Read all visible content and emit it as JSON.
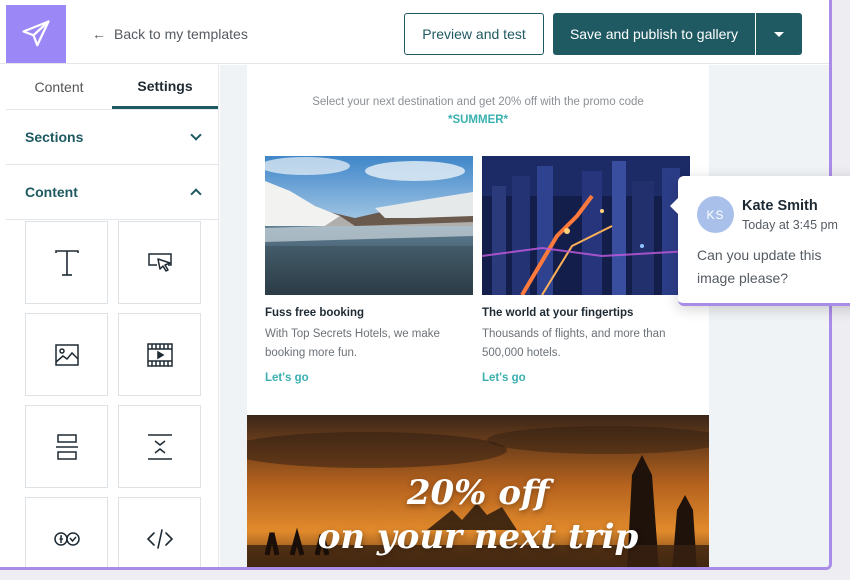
{
  "topbar": {
    "back_label": "Back to my templates",
    "preview_label": "Preview and test",
    "save_label": "Save and publish to gallery"
  },
  "sidebar": {
    "tabs": [
      {
        "label": "Content",
        "active": false
      },
      {
        "label": "Settings",
        "active": true
      }
    ],
    "sections": [
      {
        "label": "Sections",
        "expanded": false
      },
      {
        "label": "Content",
        "expanded": true
      }
    ],
    "blocks": [
      "text-icon",
      "button-icon",
      "image-icon",
      "video-icon",
      "divider-icon",
      "spacer-icon",
      "social-icon",
      "html-icon"
    ]
  },
  "email": {
    "promo_text": "Select your next destination and get 20% off with the promo code",
    "promo_code": "*SUMMER*",
    "cards": [
      {
        "title": "Fuss free booking",
        "body": "With Top Secrets Hotels, we make booking more fun.",
        "link": "Let's go"
      },
      {
        "title": "The world at your fingertips",
        "body": "Thousands of flights, and more than 500,000 hotels.",
        "link": "Let's go"
      }
    ],
    "banner_line1": "20% off",
    "banner_line2": "on your next trip"
  },
  "comment": {
    "initials": "KS",
    "name": "Kate Smith",
    "time": "Today at 3:45 pm",
    "text": "Can you update this image please?"
  },
  "colors": {
    "brand_purple": "#9b87f5",
    "primary_teal": "#1f5a62",
    "link_teal": "#3ab0b0"
  }
}
